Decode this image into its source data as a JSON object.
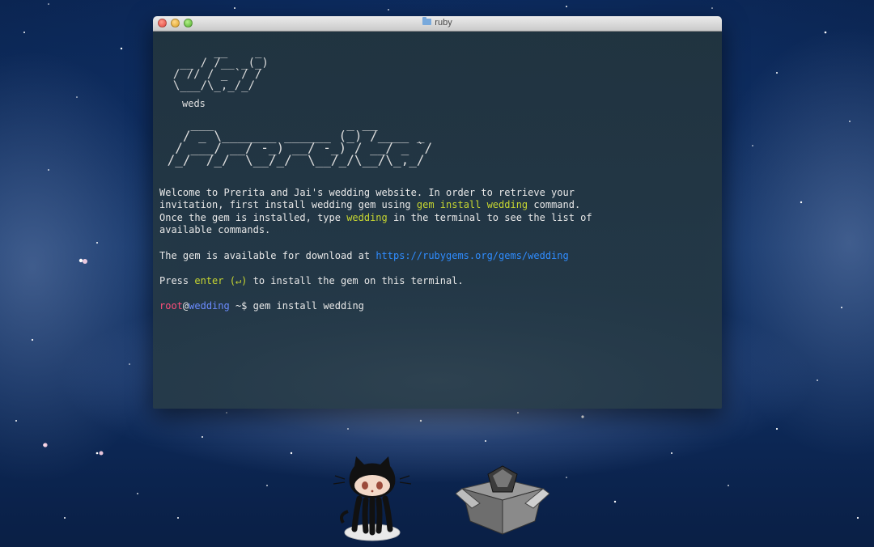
{
  "window": {
    "title": "ruby",
    "title_icon": "folder-icon"
  },
  "terminal": {
    "ascii_name1": "       __    _\n      / /__ (_)\n  __ / / _ `/ /\n / // /\\_,_/_/\n \\___/",
    "ascii_jai": "        __    _\n   __ / /__ _(_)\n  / // / _ `/ /\n  \\___/\\_,_/_/",
    "weds": "weds",
    "ascii_prerita": "    ___                 _ __\n   / _ \\_______ ______ (_) /____ _\n  / ___/ __/ -_) __/ -_) / __/ _ `/\n /_/  /_/  \\__/_/  \\__/_/\\__/\\_,_/",
    "welcome_1a": "Welcome to Prerita and Jai's wedding website. In order to retrieve your",
    "welcome_2a": "invitation, first install wedding gem using ",
    "welcome_2cmd": "gem install wedding",
    "welcome_2b": " command.",
    "welcome_3a": "Once the gem is installed, type ",
    "welcome_3cmd": "wedding",
    "welcome_3b": " in the terminal to see the list of",
    "welcome_4": "available commands.",
    "download_a": "The gem is available for download at ",
    "download_link": "https://rubygems.org/gems/wedding",
    "press_a": "Press ",
    "press_key": "enter (↵)",
    "press_b": " to install the gem on this terminal.",
    "prompt_user": "root",
    "prompt_at": "@",
    "prompt_host": "wedding",
    "prompt_path": " ~$ ",
    "prompt_cmd": "gem install wedding"
  },
  "dock": {
    "items": [
      "octocat-icon",
      "rubygems-box-icon"
    ]
  },
  "colors": {
    "command": "#c7d631",
    "link": "#2f8cff",
    "user": "#ff4f7a",
    "host": "#6b8cff"
  }
}
